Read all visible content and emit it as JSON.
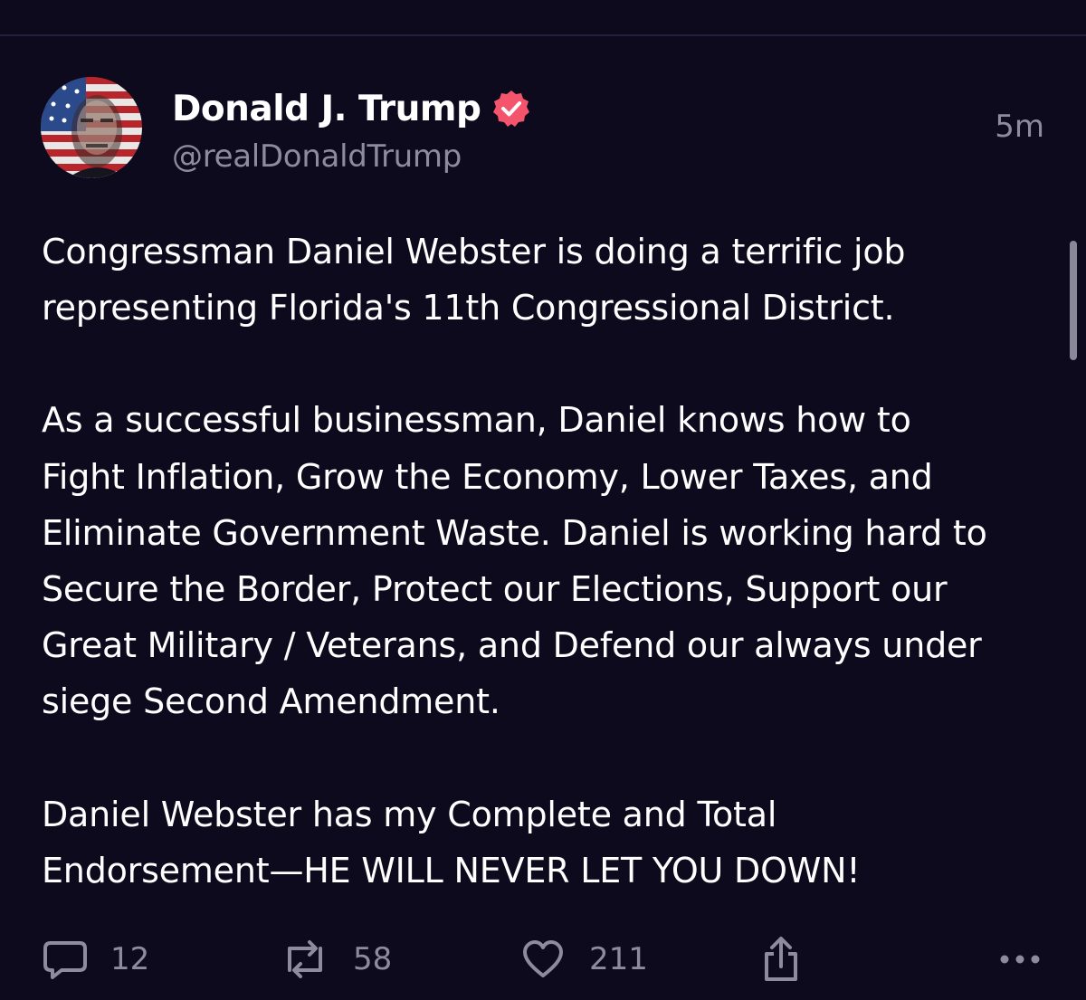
{
  "post": {
    "display_name": "Donald J. Trump",
    "handle": "@realDonaldTrump",
    "timestamp": "5m",
    "paragraphs": [
      [
        "Congressman Daniel Webster is doing a terrific job",
        "representing Florida's 11th Congressional District."
      ],
      [
        "As a successful businessman, Daniel knows how to",
        "Fight Inflation, Grow the Economy, Lower Taxes, and",
        "Eliminate Government Waste. Daniel is working hard to",
        "Secure the Border, Protect our Elections, Support our",
        "Great Military / Veterans, and Defend our always under",
        "siege Second Amendment."
      ],
      [
        "Daniel Webster has my Complete and Total",
        "Endorsement—HE WILL NEVER LET YOU DOWN!"
      ]
    ]
  },
  "actions": {
    "reply_count": "12",
    "repost_count": "58",
    "like_count": "211"
  },
  "icons": {
    "avatar": "avatar-flag-portrait",
    "verified": "verified-badge-icon",
    "reply": "reply-icon",
    "repost": "repost-icon",
    "like": "like-icon",
    "share": "share-icon",
    "more": "more-icon"
  },
  "colors": {
    "background": "#0d0a1e",
    "text_primary": "#ffffff",
    "text_secondary": "#8f8b9e",
    "verified_badge": "#f4546c"
  }
}
